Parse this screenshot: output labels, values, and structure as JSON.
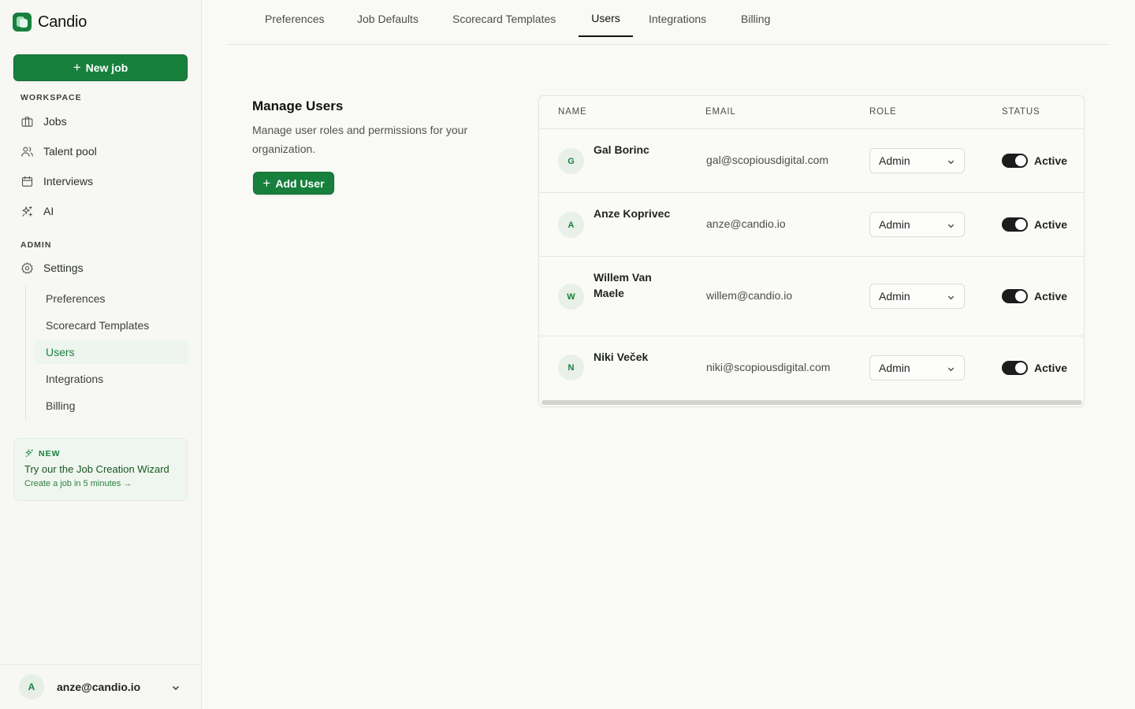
{
  "app": {
    "name": "Candio"
  },
  "sidebar": {
    "new_job_label": "New job",
    "workspace_label": "WORKSPACE",
    "workspace_items": [
      {
        "label": "Jobs",
        "icon": "briefcase-icon"
      },
      {
        "label": "Talent pool",
        "icon": "users-icon"
      },
      {
        "label": "Interviews",
        "icon": "calendar-icon"
      },
      {
        "label": "AI",
        "icon": "sparkles-icon"
      }
    ],
    "admin_label": "ADMIN",
    "settings_label": "Settings",
    "settings_items": [
      {
        "label": "Preferences"
      },
      {
        "label": "Scorecard Templates"
      },
      {
        "label": "Users",
        "active": true
      },
      {
        "label": "Integrations"
      },
      {
        "label": "Billing"
      }
    ],
    "promo": {
      "tag": "NEW",
      "title": "Try our the Job Creation Wizard",
      "link": "Create a job in 5 minutes →"
    },
    "account": {
      "initial": "A",
      "email": "anze@candio.io"
    }
  },
  "tabs": [
    {
      "label": "Preferences"
    },
    {
      "label": "Job Defaults"
    },
    {
      "label": "Scorecard Templates"
    },
    {
      "label": "Users",
      "active": true
    },
    {
      "label": "Integrations"
    },
    {
      "label": "Billing"
    }
  ],
  "main": {
    "title": "Manage Users",
    "description": "Manage user roles and permissions for your organization.",
    "add_user_label": "Add User",
    "table": {
      "columns": [
        "NAME",
        "EMAIL",
        "ROLE",
        "STATUS"
      ],
      "rows": [
        {
          "initial": "G",
          "name": "Gal Borinc",
          "email": "gal@scopiousdigital.com",
          "role": "Admin",
          "status": "Active"
        },
        {
          "initial": "A",
          "name": "Anze Koprivec",
          "email": "anze@candio.io",
          "role": "Admin",
          "status": "Active"
        },
        {
          "initial": "W",
          "name": "Willem Van Maele",
          "email": "willem@candio.io",
          "role": "Admin",
          "status": "Active"
        },
        {
          "initial": "N",
          "name": "Niki Veček",
          "email": "niki@scopiousdigital.com",
          "role": "Admin",
          "status": "Active"
        }
      ]
    }
  },
  "colors": {
    "brand": "#17803d",
    "toggle_on": "#1c1c1c"
  }
}
